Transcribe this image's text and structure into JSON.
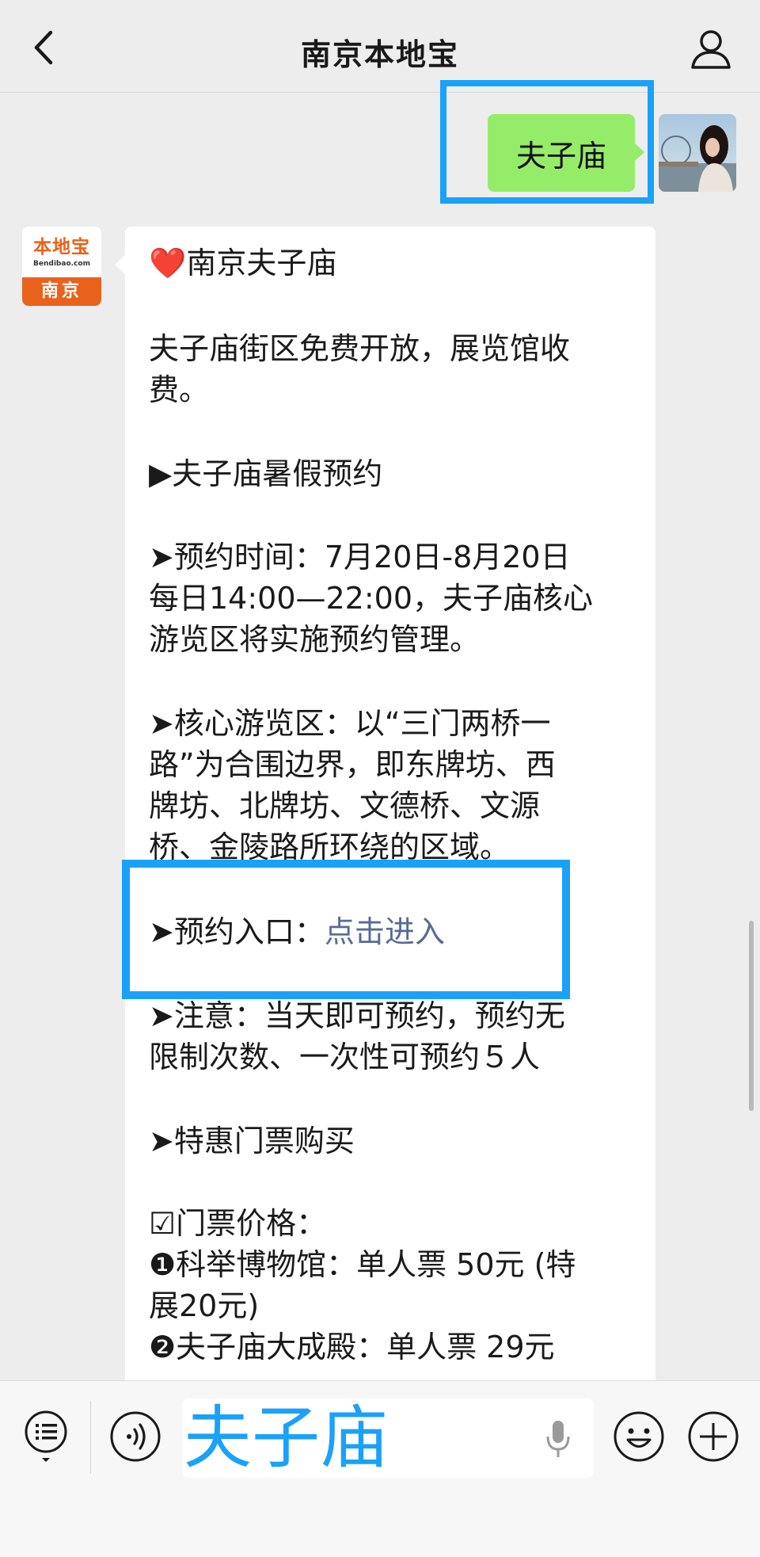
{
  "header": {
    "title": "南京本地宝",
    "back_icon": "chevron-left-icon",
    "profile_icon": "person-icon"
  },
  "outgoing": {
    "text": "夫子庙"
  },
  "bot": {
    "avatar_brand": "本地宝",
    "avatar_site": "Bendibao.com",
    "avatar_city": "南京"
  },
  "message": {
    "heading": "南京夫子庙",
    "heart": "❤️",
    "lines": [
      "夫子庙街区免费开放，展览馆收",
      "费。",
      "▶夫子庙暑假预约",
      "➤预约时间：7月20日-8月20日",
      "每日14:00—22:00，夫子庙核心",
      "游览区将实施预约管理。",
      "➤核心游览区：以“三门两桥一",
      "路”为合围边界，即东牌坊、西",
      "牌坊、北牌坊、文德桥、文源",
      "桥、金陵路所环绕的区域。",
      "➤预约入口：",
      "点击进入",
      "➤注意：当天即可预约，预约无",
      "限制次数、一次性可预约５人",
      "➤特惠门票购买",
      "☑门票价格：",
      "❶科举博物馆：单人票 50元 (特",
      "展20元)",
      "❷夫子庙大成殿：单人票 29元"
    ]
  },
  "input": {
    "value": "夫子庙"
  },
  "colors": {
    "highlight": "#1aa1f8",
    "bubble_green": "#95ec69",
    "link": "#576b95",
    "brand_orange": "#e8621c"
  }
}
